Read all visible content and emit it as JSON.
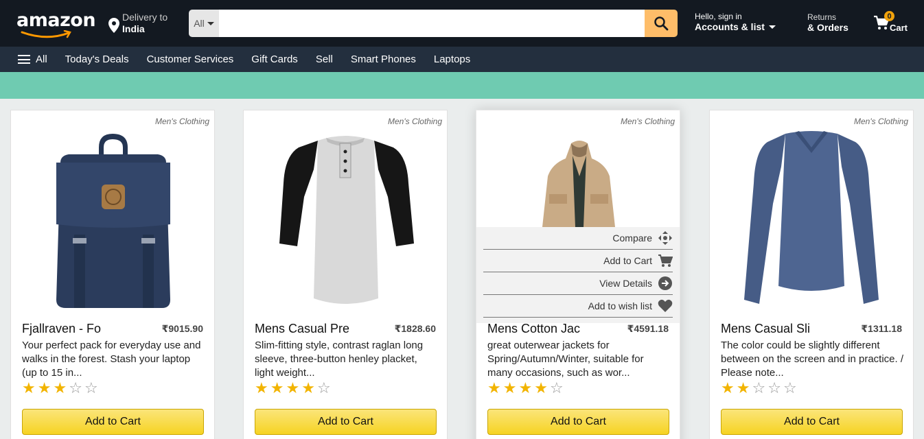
{
  "header": {
    "logo": "amazon",
    "delivery": {
      "line1": "Delivery to",
      "line2": "India"
    },
    "search": {
      "category": "All",
      "placeholder": "",
      "value": ""
    },
    "account": {
      "line1": "Hello, sign in",
      "line2": "Accounts & list"
    },
    "returns": {
      "line1": "Returns",
      "line2": "& Orders"
    },
    "cart": {
      "count": "0",
      "label": "Cart"
    }
  },
  "nav": {
    "all": "All",
    "items": [
      "Today's Deals",
      "Customer Services",
      "Gift Cards",
      "Sell",
      "Smart Phones",
      "Laptops"
    ]
  },
  "colors": {
    "accent": "#febd69",
    "banner": "#6fcbb1",
    "header": "#131921",
    "nav": "#232f3e"
  },
  "products": [
    {
      "category": "Men's Clothing",
      "title": "Fjallraven - Fo",
      "price": "₹9015.90",
      "description": "Your perfect pack for everyday use and walks in the forest. Stash your laptop (up to 15 in...",
      "rating": 3,
      "button": "Add to Cart",
      "image": "backpack"
    },
    {
      "category": "Men's Clothing",
      "title": "Mens Casual Pre",
      "price": "₹1828.60",
      "description": "Slim-fitting style, contrast raglan long sleeve, three-button henley placket, light weight...",
      "rating": 4,
      "button": "Add to Cart",
      "image": "raglan-tshirt"
    },
    {
      "category": "Men's Clothing",
      "title": "Mens Cotton Jac",
      "price": "₹4591.18",
      "description": "great outerwear jackets for Spring/Autumn/Winter, suitable for many occasions, such as wor...",
      "rating": 4,
      "button": "Add to Cart",
      "image": "jacket",
      "hover_menu": [
        "Compare",
        "Add to Cart",
        "View Details",
        "Add to wish list"
      ]
    },
    {
      "category": "Men's Clothing",
      "title": "Mens Casual Sli",
      "price": "₹1311.18",
      "description": "The color could be slightly different between on the screen and in practice. / Please note...",
      "rating": 2,
      "button": "Add to Cart",
      "image": "longsleeve-shirt"
    }
  ]
}
